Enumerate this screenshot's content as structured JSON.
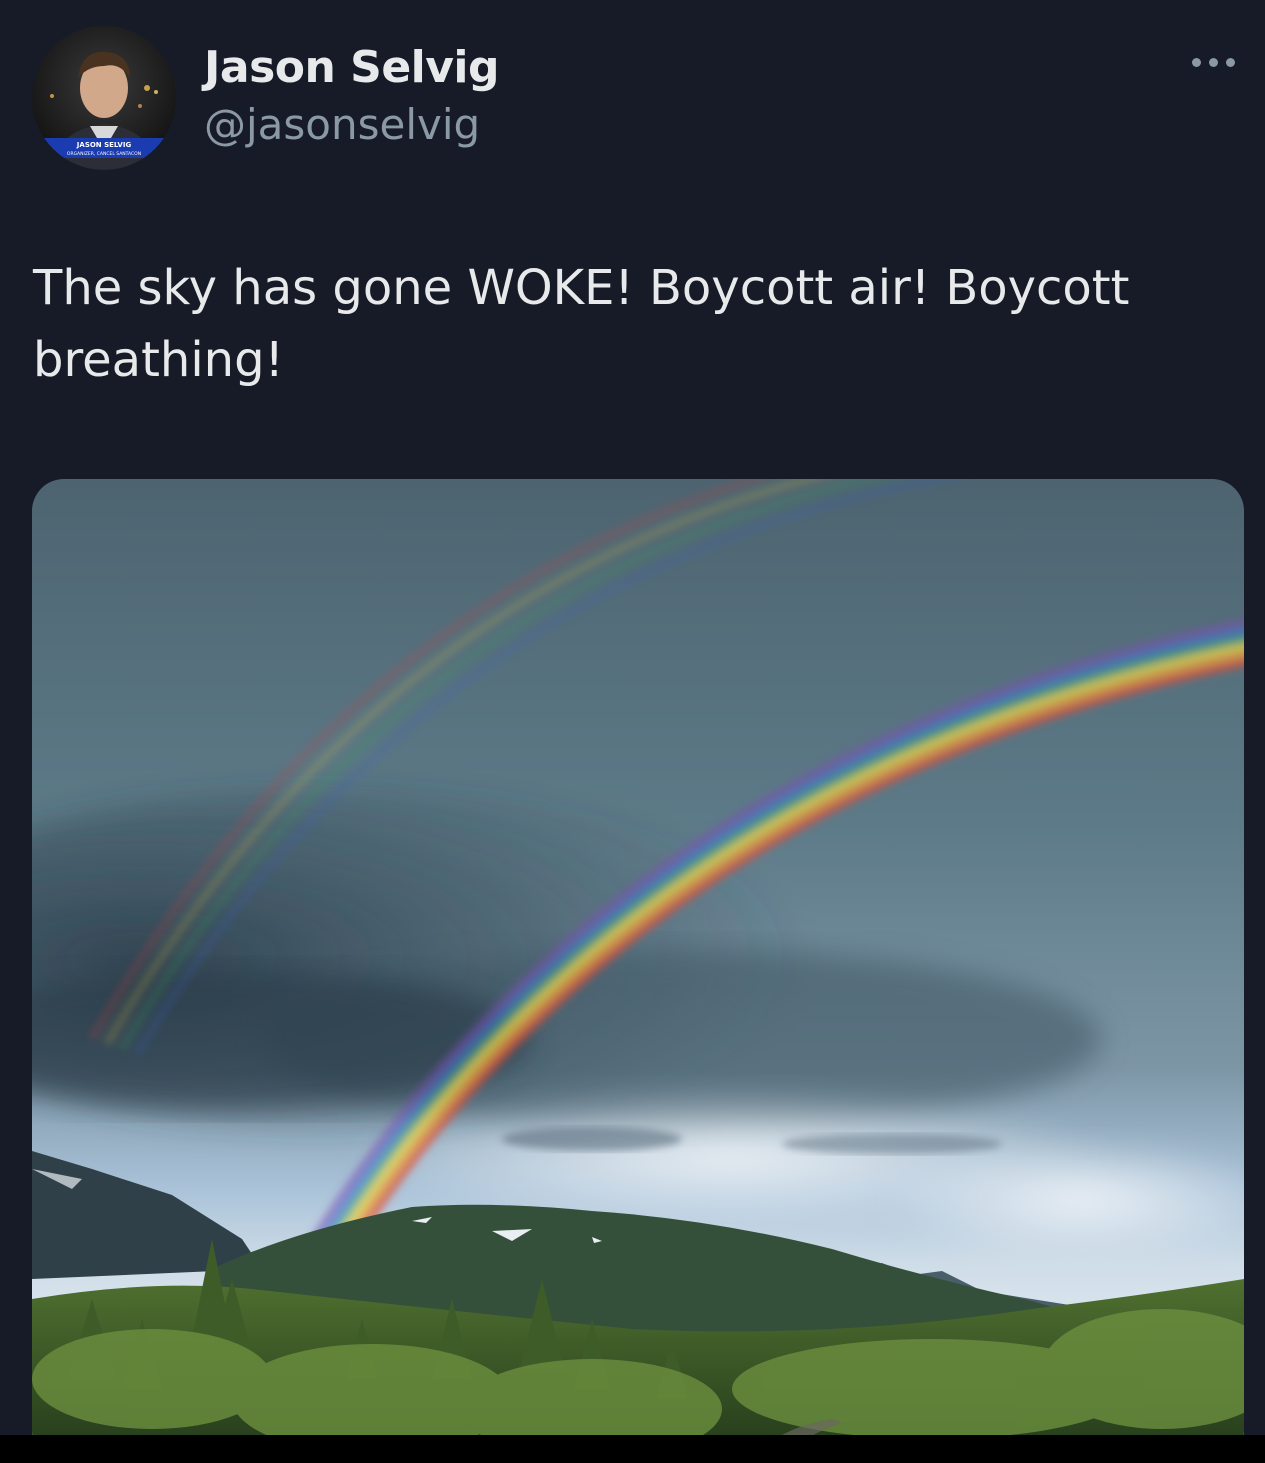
{
  "tweet": {
    "author": {
      "display_name": "Jason Selvig",
      "handle": "@jasonselvig",
      "avatar_icon": "avatar-photo",
      "avatar_caption_line1": "JASON SELVIG",
      "avatar_caption_line2": "ORGANIZER, CANCEL SANTACON"
    },
    "more_icon": "more-horizontal-icon",
    "text": "The sky has gone WOKE! Boycott air! Boycott breathing!",
    "media": {
      "kind": "photo"
    }
  },
  "colors": {
    "background": "#161b27",
    "primary_text": "#e7e9ea",
    "secondary_text": "#8b98a5"
  }
}
